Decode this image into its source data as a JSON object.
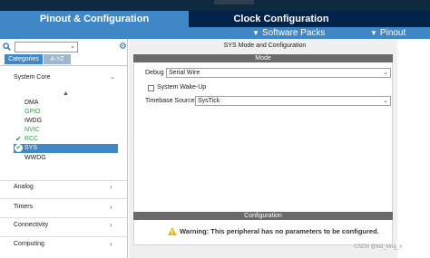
{
  "header": {
    "tabs": [
      {
        "label": "Pinout & Configuration"
      },
      {
        "label": "Clock Configuration"
      }
    ]
  },
  "submenu": {
    "software_packs": "Software Packs",
    "pinout": "Pinout"
  },
  "sidebar": {
    "category_tabs": [
      "Categories",
      "A->Z"
    ],
    "system_core": "System Core",
    "peripherals": [
      "DMA",
      "GPIO",
      "IWDG",
      "NVIC",
      "RCC",
      "SYS",
      "WWDG"
    ],
    "categories": [
      "Analog",
      "Timers",
      "Connectivity",
      "Computing"
    ]
  },
  "main": {
    "title": "SYS Mode and Configuration",
    "mode_header": "Mode",
    "debug_label": "Debug",
    "debug_value": "Serial Wire",
    "wakeup_label": "System Wake-Up",
    "timebase_label": "Timebase Source",
    "timebase_value": "SysTick",
    "config_header": "Configuration",
    "warning": "Warning: This peripheral has no parameters to be configured."
  },
  "watermark": "CSDN @kid_king_x",
  "colors": {
    "accent": "#3f87c6",
    "navy": "#03234b",
    "enabled_green": "#2ea043"
  }
}
